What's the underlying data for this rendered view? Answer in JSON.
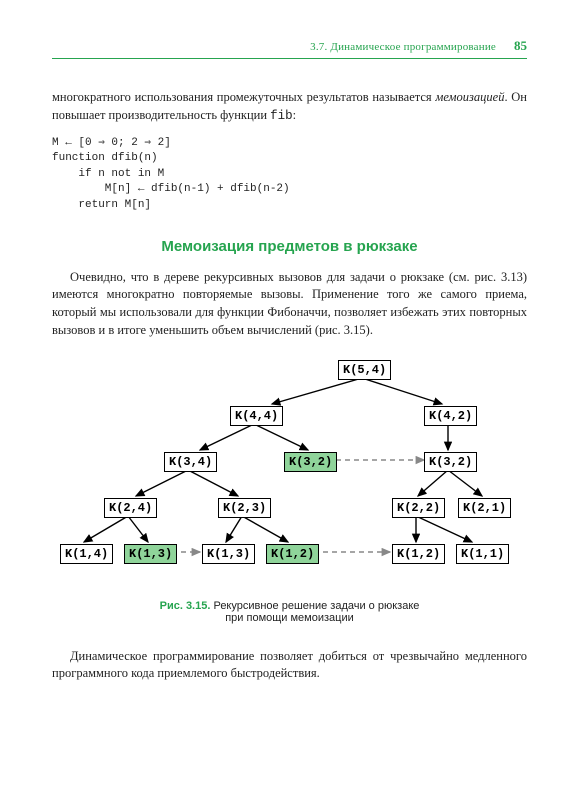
{
  "header": {
    "section": "3.7. Динамическое программирование",
    "page": "85"
  },
  "para1_a": "многократного использования промежуточных результатов называется ",
  "para1_b": "мемоизацией",
  "para1_c": ". Он повышает производительность функции ",
  "para1_d": "fib",
  "para1_e": ":",
  "code": "M ← [0 ⇒ 0; 2 ⇒ 2]\nfunction dfib(n)\n    if n not in M\n        M[n] ← dfib(n-1) + dfib(n-2)\n    return M[n]",
  "subheading": "Мемоизация предметов в рюкзаке",
  "para2": "Очевидно, что в дереве рекурсивных вызовов для задачи о рюкзаке (см. рис. 3.13) имеются многократно повторяемые вызовы. Применение того же самого приема, который мы использовали для функции Фибоначчи, позволяет избежать этих повторных вызовов и в итоге уменьшить объем вычислений (рис. 3.15).",
  "fig": {
    "nodes": {
      "n54": "K(5,4)",
      "n44": "K(4,4)",
      "n42": "K(4,2)",
      "n34": "K(3,4)",
      "n32a": "K(3,2)",
      "n32b": "K(3,2)",
      "n24": "K(2,4)",
      "n23": "K(2,3)",
      "n22": "K(2,2)",
      "n21": "K(2,1)",
      "n14": "K(1,4)",
      "n13a": "K(1,3)",
      "n13b": "K(1,3)",
      "n12a": "K(1,2)",
      "n12b": "K(1,2)",
      "n11": "K(1,1)"
    },
    "caption_label": "Рис. 3.15.",
    "caption_text_a": " Рекурсивное решение задачи о рюкзаке",
    "caption_text_b": "при помощи мемоизации"
  },
  "para3": "Динамическое программирование позволяет добиться от чрезвычайно медленного программного кода приемлемого быстродействия.",
  "chart_data": {
    "type": "tree",
    "title": "Рис. 3.15. Рекурсивное решение задачи о рюкзаке при помощи мемоизации",
    "nodes": [
      {
        "id": "K(5,4)",
        "memoized": false
      },
      {
        "id": "K(4,4)",
        "memoized": false
      },
      {
        "id": "K(4,2)",
        "memoized": false
      },
      {
        "id": "K(3,4)",
        "memoized": false
      },
      {
        "id": "K(3,2)_a",
        "label": "K(3,2)",
        "memoized": true
      },
      {
        "id": "K(3,2)_b",
        "label": "K(3,2)",
        "memoized": false
      },
      {
        "id": "K(2,4)",
        "memoized": false
      },
      {
        "id": "K(2,3)",
        "memoized": false
      },
      {
        "id": "K(2,2)",
        "memoized": false
      },
      {
        "id": "K(2,1)",
        "memoized": false
      },
      {
        "id": "K(1,4)",
        "memoized": false
      },
      {
        "id": "K(1,3)_a",
        "label": "K(1,3)",
        "memoized": true
      },
      {
        "id": "K(1,3)_b",
        "label": "K(1,3)",
        "memoized": false
      },
      {
        "id": "K(1,2)_a",
        "label": "K(1,2)",
        "memoized": true
      },
      {
        "id": "K(1,2)_b",
        "label": "K(1,2)",
        "memoized": false
      },
      {
        "id": "K(1,1)",
        "memoized": false
      }
    ],
    "solid_edges": [
      [
        "K(5,4)",
        "K(4,4)"
      ],
      [
        "K(5,4)",
        "K(4,2)"
      ],
      [
        "K(4,4)",
        "K(3,4)"
      ],
      [
        "K(4,4)",
        "K(3,2)_a"
      ],
      [
        "K(4,2)",
        "K(3,2)_b"
      ],
      [
        "K(3,4)",
        "K(2,4)"
      ],
      [
        "K(3,4)",
        "K(2,3)"
      ],
      [
        "K(3,2)_b",
        "K(2,2)"
      ],
      [
        "K(3,2)_b",
        "K(2,1)"
      ],
      [
        "K(2,4)",
        "K(1,4)"
      ],
      [
        "K(2,4)",
        "K(1,3)_a"
      ],
      [
        "K(2,3)",
        "K(1,3)_b"
      ],
      [
        "K(2,3)",
        "K(1,2)_a"
      ],
      [
        "K(2,2)",
        "K(1,2)_b"
      ],
      [
        "K(2,2)",
        "K(1,1)"
      ]
    ],
    "dashed_memo_edges": [
      [
        "K(3,2)_a",
        "K(3,2)_b"
      ],
      [
        "K(1,3)_a",
        "K(1,3)_b"
      ],
      [
        "K(1,2)_a",
        "K(1,2)_b"
      ]
    ]
  }
}
